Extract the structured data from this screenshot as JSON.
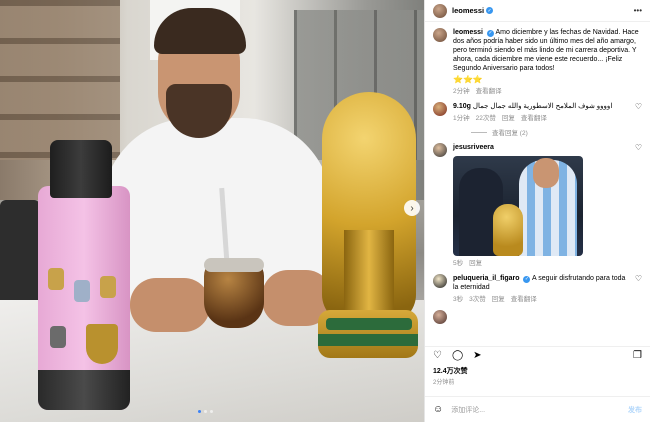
{
  "post": {
    "username": "leomessi",
    "more_icon": "more-horizontal-icon"
  },
  "caption": {
    "username": "leomessi",
    "text": "Amo diciembre y las fechas de Navidad. Hace dos años podría haber sido un último mes del año amargo, pero terminó siendo el más lindo de mi carrera deportiva. Y ahora, cada diciembre me viene este recuerdo... ¡Feliz Segundo Aniversario para todos!",
    "stars": "⭐⭐⭐",
    "time": "2分钟",
    "translate": "查看翻译"
  },
  "comments": [
    {
      "username": "9.10g",
      "text": "اوووو شوف الملامح الاسطورية والله جمال جمال",
      "time": "1分钟",
      "likes": "22次赞",
      "reply": "回复",
      "translate": "查看翻译",
      "view_replies": "查看回复 (2)"
    },
    {
      "username": "jesusriveera",
      "time": "5秒",
      "reply": "回复"
    },
    {
      "username": "peluqueria_il_figaro",
      "text": "A seguir disfrutando para toda la eternidad",
      "time": "3秒",
      "likes": "3次赞",
      "reply": "回复",
      "translate": "查看翻译"
    }
  ],
  "stats": {
    "likes": "12.4万次赞",
    "ago": "2分钟前"
  },
  "composer": {
    "placeholder": "添加评论...",
    "post_label": "发布"
  },
  "colors": {
    "verified": "#3897f0",
    "link_blue": "#b2d7fb"
  }
}
